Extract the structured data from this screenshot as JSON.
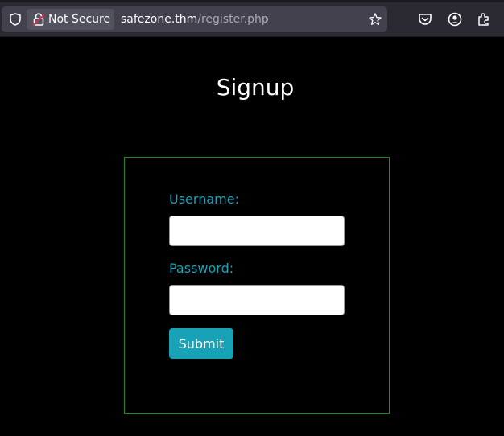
{
  "browser": {
    "security_label": "Not Secure",
    "url_host": "safezone.thm",
    "url_path": "/register.php"
  },
  "page": {
    "title": "Signup"
  },
  "form": {
    "username_label": "Username:",
    "username_value": "",
    "password_label": "Password:",
    "password_value": "",
    "submit_label": "Submit"
  },
  "colors": {
    "accent": "#17a2b8",
    "form_border": "#1b8a1b",
    "page_background": "#000000"
  }
}
